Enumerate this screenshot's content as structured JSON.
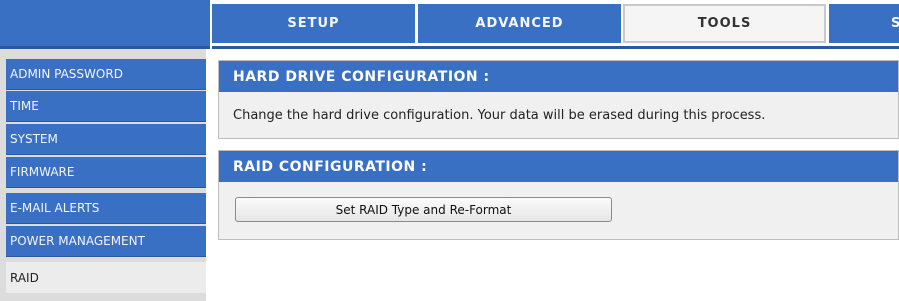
{
  "nav": {
    "tabs": [
      {
        "label": "SETUP",
        "active": false
      },
      {
        "label": "ADVANCED",
        "active": false
      },
      {
        "label": "TOOLS",
        "active": true
      },
      {
        "label": "S",
        "active": false
      }
    ]
  },
  "sidebar": {
    "items": [
      {
        "label": "ADMIN PASSWORD",
        "active": false
      },
      {
        "label": "TIME",
        "active": false
      },
      {
        "label": "SYSTEM",
        "active": false
      },
      {
        "label": "FIRMWARE",
        "active": false
      },
      {
        "label": "E-MAIL ALERTS",
        "active": false
      },
      {
        "label": "POWER MANAGEMENT",
        "active": false
      },
      {
        "label": "RAID",
        "active": true
      }
    ]
  },
  "main": {
    "hard_drive_section": {
      "title": "HARD DRIVE CONFIGURATION :",
      "description": "Change the hard drive configuration. Your data will be erased during this process."
    },
    "raid_section": {
      "title": "RAID CONFIGURATION :",
      "button_label": "Set RAID Type and Re-Format"
    }
  },
  "colors": {
    "accent_blue": "#3a70c4",
    "dark_blue": "#2b57a0",
    "panel_gray": "#f0f0f0"
  }
}
